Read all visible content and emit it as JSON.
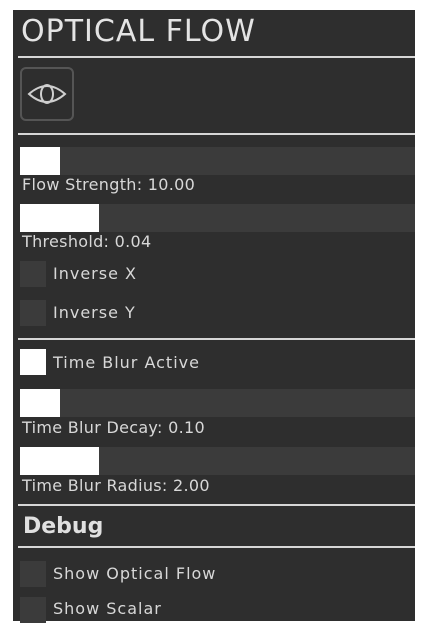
{
  "panel": {
    "title": "OPTICAL FLOW",
    "eye_icon": "eye-icon"
  },
  "controls": {
    "flow_strength": {
      "label": "Flow Strength: 10.00",
      "fill_fraction": 0.1
    },
    "threshold": {
      "label": "Threshold: 0.04",
      "fill_fraction": 0.2
    },
    "inverse_x": {
      "label": "Inverse X",
      "checked": false
    },
    "inverse_y": {
      "label": "Inverse Y",
      "checked": false
    },
    "time_blur_active": {
      "label": "Time Blur Active",
      "checked": true
    },
    "time_blur_decay": {
      "label": "Time Blur Decay: 0.10",
      "fill_fraction": 0.1
    },
    "time_blur_radius": {
      "label": "Time Blur Radius: 2.00",
      "fill_fraction": 0.2
    }
  },
  "debug": {
    "title": "Debug",
    "show_optical_flow": {
      "label": "Show Optical Flow",
      "checked": false
    },
    "show_scalar": {
      "label": "Show Scalar",
      "checked": false
    }
  },
  "colors": {
    "panel_bg": "#2e2e2e",
    "track": "#3b3b3b",
    "fill": "#ffffff",
    "text": "#d8d8d8"
  }
}
